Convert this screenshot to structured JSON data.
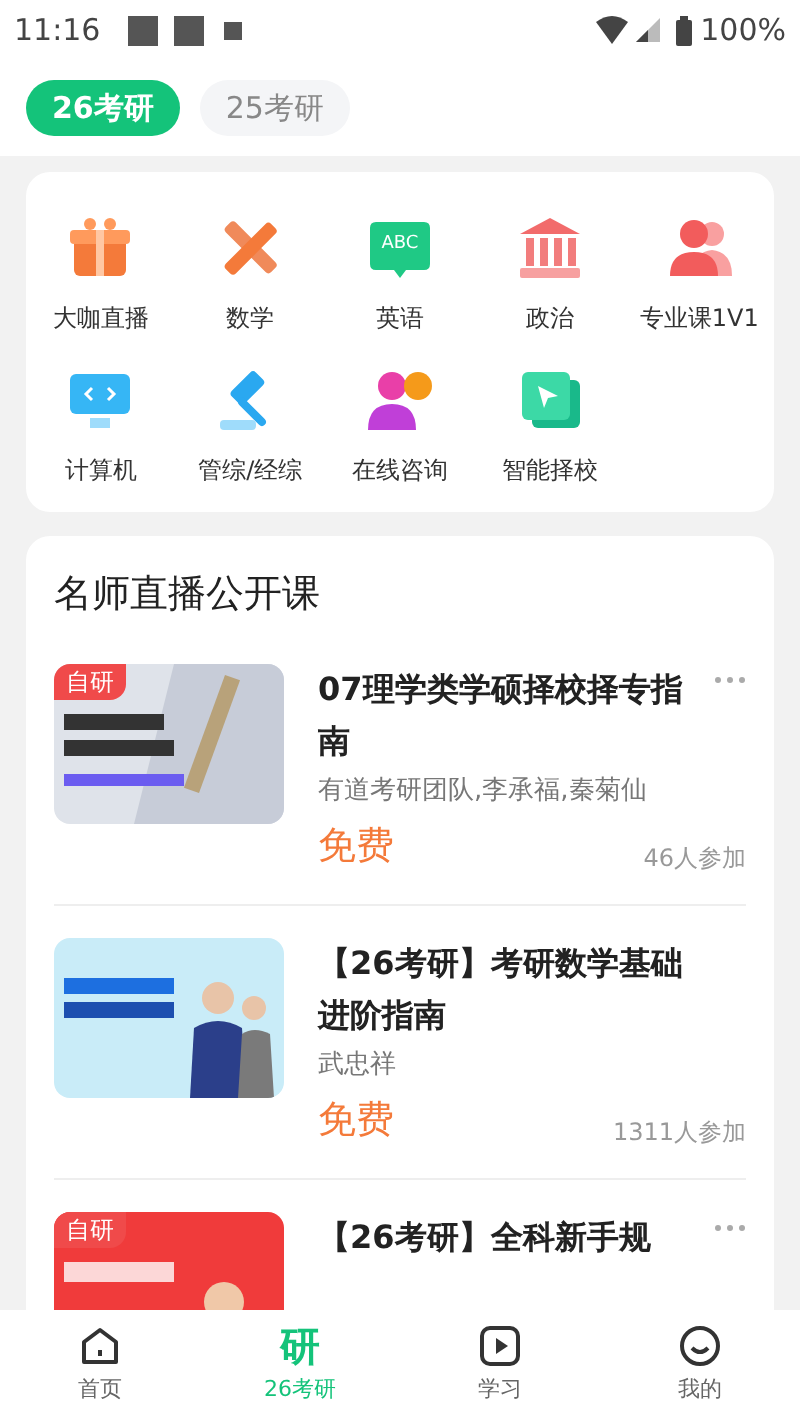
{
  "status_bar": {
    "time": "11:16",
    "battery": "100%"
  },
  "tabs": [
    {
      "label": "26考研",
      "selected": true
    },
    {
      "label": "25考研",
      "selected": false
    }
  ],
  "categories": [
    {
      "label": "大咖直播"
    },
    {
      "label": "数学"
    },
    {
      "label": "英语",
      "icon_text": "ABC"
    },
    {
      "label": "政治"
    },
    {
      "label": "专业课1V1"
    },
    {
      "label": "计算机"
    },
    {
      "label": "管综/经综"
    },
    {
      "label": "在线咨询"
    },
    {
      "label": "智能择校"
    }
  ],
  "section": {
    "title": "名师直播公开课"
  },
  "courses": [
    {
      "badge": "自研",
      "title": "07理学类学硕择校择专指南",
      "teachers": "有道考研团队,李承福,秦菊仙",
      "price": "免费",
      "count": "46人参加",
      "more": true
    },
    {
      "title": "【26考研】考研数学基础进阶指南",
      "teachers": "武忠祥",
      "price": "免费",
      "count": "1311人参加",
      "more": false
    },
    {
      "badge": "自研",
      "title": "【26考研】全科新手规",
      "more": true
    }
  ],
  "bottom_nav": [
    {
      "label": "首页",
      "selected": false,
      "kind": "icon"
    },
    {
      "label": "26考研",
      "selected": true,
      "kind": "glyph",
      "glyph": "研"
    },
    {
      "label": "学习",
      "selected": false,
      "kind": "icon"
    },
    {
      "label": "我的",
      "selected": false,
      "kind": "icon"
    }
  ]
}
